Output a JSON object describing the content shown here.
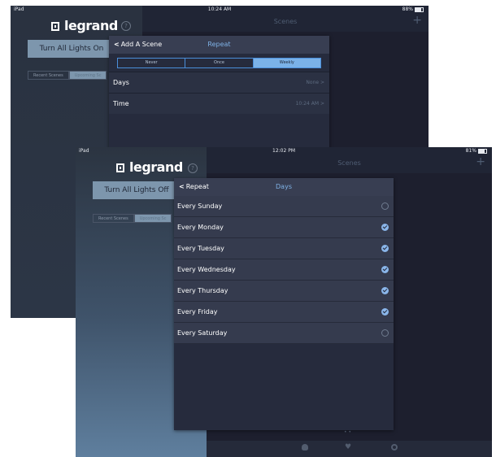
{
  "screen1": {
    "status": {
      "carrier": "iPad",
      "time": "10:24 AM",
      "battery": "88%"
    },
    "logo": "legrand",
    "lights_button": "Turn All Lights On",
    "scene_tabs": [
      "Recent Scenes",
      "Upcoming Sc"
    ],
    "scenes_title": "Scenes",
    "modal": {
      "back_label": "Add A Scene",
      "title": "Repeat",
      "segments": [
        "Never",
        "Once",
        "Weekly"
      ],
      "selected_segment": "Weekly",
      "rows": [
        {
          "label": "Days",
          "value": "None >"
        },
        {
          "label": "Time",
          "value": "10:24 AM >"
        }
      ]
    }
  },
  "screen2": {
    "status": {
      "carrier": "iPad",
      "time": "12:02 PM",
      "battery": "81%"
    },
    "logo": "legrand",
    "lights_button": "Turn All Lights Off",
    "scene_tabs": [
      "Recent Scenes",
      "Upcoming Sc"
    ],
    "scenes_title": "Scenes",
    "modal": {
      "back_label": "Repeat",
      "title": "Days",
      "days": [
        {
          "label": "Every Sunday",
          "checked": false
        },
        {
          "label": "Every Monday",
          "checked": true
        },
        {
          "label": "Every Tuesday",
          "checked": true
        },
        {
          "label": "Every Wednesday",
          "checked": true
        },
        {
          "label": "Every Thursday",
          "checked": true
        },
        {
          "label": "Every Friday",
          "checked": true
        },
        {
          "label": "Every Saturday",
          "checked": false
        }
      ]
    },
    "page_dots": "• •",
    "tab_icons": [
      "bulb-icon",
      "heart-icon",
      "gear-icon"
    ]
  },
  "colors": {
    "accent": "#7bb2e8",
    "panel": "#262b3d",
    "button": "#7d96ad"
  }
}
